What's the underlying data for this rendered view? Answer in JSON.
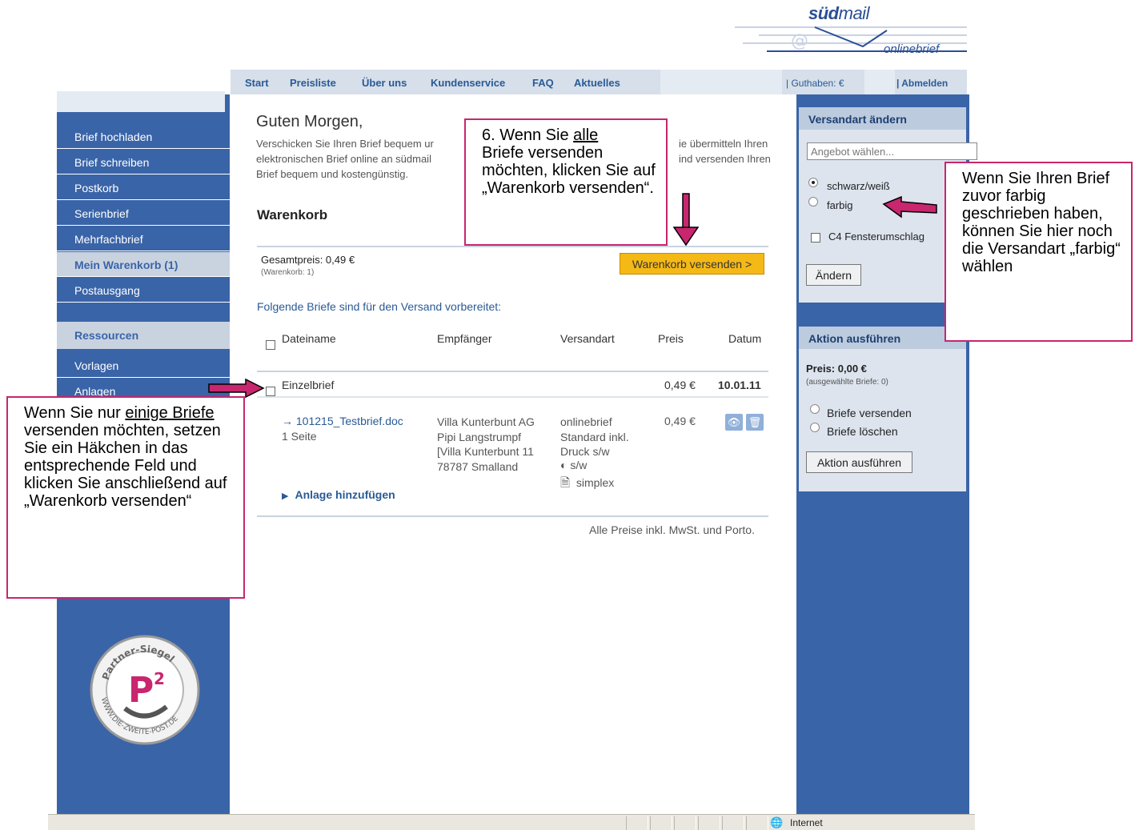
{
  "logo": {
    "brand_bold": "süd",
    "brand_light": "mail",
    "product": "onlinebrief"
  },
  "topnav": {
    "items": [
      "Start",
      "Preisliste",
      "Über uns",
      "Kundenservice",
      "FAQ",
      "Aktuelles"
    ],
    "balance": "| Guthaben: €",
    "logout": "| Abmelden"
  },
  "leftnav": {
    "items": [
      "Brief hochladen",
      "Brief schreiben",
      "Postkorb",
      "Serienbrief",
      "Mehrfachbrief",
      "Mein Warenkorb (1)",
      "Postausgang"
    ],
    "section": "Ressourcen",
    "resources": [
      "Vorlagen",
      "Anlagen"
    ]
  },
  "seal": {
    "text_top": "Partner-Siegel",
    "text_bottom": "WWW.DIE-ZWEITE-POST.DE",
    "letter": "P",
    "sup": "2"
  },
  "main": {
    "greeting": "Guten Morgen,",
    "intro_line1a": "Verschicken Sie Ihren Brief bequem ur",
    "intro_line1b": "ie übermitteln Ihren",
    "intro_line2a": "elektronischen Brief online an südmail",
    "intro_line2b": "ind versenden Ihren",
    "intro_line3": "Brief bequem und kostengünstig.",
    "cart_title": "Warenkorb",
    "total_label": "Gesamtpreis: 0,49 €",
    "total_sub": "(Warenkorb: 1)",
    "send_cart_button": "Warenkorb versenden >",
    "prepared_text": "Folgende Briefe sind für den Versand vorbereitet:",
    "columns": {
      "filename": "Dateiname",
      "recipient": "Empfänger",
      "shipping": "Versandart",
      "price": "Preis",
      "date": "Datum"
    },
    "group": {
      "name": "Einzelbrief",
      "price": "0,49 €",
      "date": "10.01.11"
    },
    "item": {
      "file": "→ 101215_Testbrief.doc",
      "pages": "1 Seite",
      "recipient": [
        "Villa Kunterbunt AG",
        "Pipi Langstrumpf",
        "[Villa Kunterbunt 11",
        "78787 Smalland"
      ],
      "shipping": [
        "onlinebrief",
        "Standard inkl.",
        "Druck s/w"
      ],
      "color_mode": "s/w",
      "duplex": "simplex",
      "price": "0,49 €"
    },
    "add_attachment": "Anlage hinzufügen",
    "footer_note": "Alle Preise inkl. MwSt. und Porto."
  },
  "rightpanel": {
    "shipping_title": "Versandart ändern",
    "offer_placeholder": "Angebot wählen...",
    "options": [
      "schwarz/weiß",
      "farbig"
    ],
    "envelope": "C4 Fensterumschlag",
    "change_button": "Ändern",
    "action_title": "Aktion ausführen",
    "action_price": "Preis: 0,00 €",
    "action_sub": "(ausgewählte Briefe: 0)",
    "actions": [
      "Briefe versenden",
      "Briefe löschen"
    ],
    "action_button": "Aktion ausführen"
  },
  "annotations": {
    "top_prefix": "6. Wenn Sie ",
    "top_underlined": "alle",
    "top_rest": "Briefe versenden möchten, klicken Sie auf „Warenkorb versenden“.",
    "left_prefix": "Wenn Sie nur ",
    "left_underlined": "einige Briefe",
    "left_rest": " versenden möchten, setzen Sie ein Häkchen in das entsprechende Feld und klicken Sie anschließend auf „Warenkorb versenden“",
    "right_text": "Wenn Sie Ihren Brief zuvor farbig geschrieben haben, können Sie hier noch die Versandart „farbig“ wählen"
  },
  "statusbar": {
    "zone": "Internet"
  },
  "colors": {
    "brand_blue": "#3a64a8",
    "highlight": "#c8266e",
    "button_yellow": "#f5b916"
  }
}
